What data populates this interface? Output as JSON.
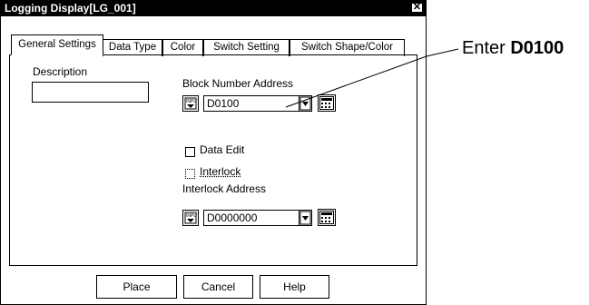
{
  "window": {
    "title": "Logging Display[LG_001]",
    "close_glyph": "✕"
  },
  "tabs": [
    {
      "label": "General Settings",
      "active": true
    },
    {
      "label": "Data Type",
      "active": false
    },
    {
      "label": "Color",
      "active": false
    },
    {
      "label": "Switch Setting",
      "active": false
    },
    {
      "label": "Switch Shape/Color",
      "active": false
    }
  ],
  "general": {
    "description_label": "Description",
    "description_value": "",
    "block_number_label": "Block Number Address",
    "block_number_value": "D0100",
    "data_edit_label": "Data Edit",
    "data_edit_checked": false,
    "interlock_label": "Interlock",
    "interlock_checked": false,
    "interlock_enabled": false,
    "interlock_address_label": "Interlock Address",
    "interlock_address_value": "D0000000"
  },
  "buttons": {
    "place": "Place",
    "cancel": "Cancel",
    "help": "Help"
  },
  "annotation": {
    "prefix": "Enter ",
    "emphasis": "D0100"
  }
}
